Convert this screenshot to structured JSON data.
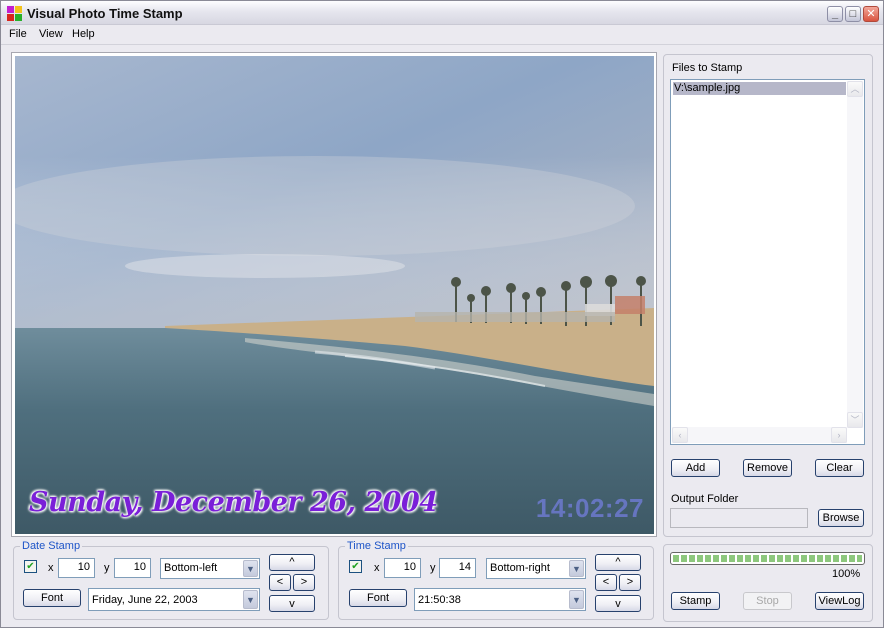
{
  "window": {
    "title": "Visual Photo Time Stamp",
    "icons": {
      "app": "app-logo-icon",
      "minimize": "minimize-icon",
      "maximize": "maximize-icon",
      "close": "close-icon"
    }
  },
  "menu": [
    "File",
    "View",
    "Help"
  ],
  "preview": {
    "date_overlay": "Sunday, December 26, 2004",
    "time_overlay": "14:02:27"
  },
  "files_panel": {
    "title": "Files to Stamp",
    "files": [
      "V:\\sample.jpg"
    ],
    "add_label": "Add",
    "remove_label": "Remove",
    "clear_label": "Clear",
    "output_folder_label": "Output Folder",
    "output_folder_value": "",
    "browse_label": "Browse"
  },
  "date_stamp": {
    "title": "Date Stamp",
    "enabled": true,
    "x_label": "x",
    "x_value": "10",
    "y_label": "y",
    "y_value": "10",
    "position": "Bottom-left",
    "font_label": "Font",
    "format": "Friday, June 22, 2003",
    "nudge": {
      "up": "^",
      "left": "<",
      "right": ">",
      "down": "v"
    }
  },
  "time_stamp": {
    "title": "Time Stamp",
    "enabled": true,
    "x_label": "x",
    "x_value": "10",
    "y_label": "y",
    "y_value": "14",
    "position": "Bottom-right",
    "font_label": "Font",
    "format": "21:50:38",
    "nudge": {
      "up": "^",
      "left": "<",
      "right": ">",
      "down": "v"
    }
  },
  "progress": {
    "percent": 100,
    "percent_label": "100%",
    "stamp_label": "Stamp",
    "stop_label": "Stop",
    "viewlog_label": "ViewLog"
  },
  "colors": {
    "group_title": "#1e55c8",
    "date_overlay": "#7a1fd8",
    "time_overlay": "#6a78c8",
    "progress_fill": "#8dc77d",
    "selection": "#b6b7c9"
  }
}
